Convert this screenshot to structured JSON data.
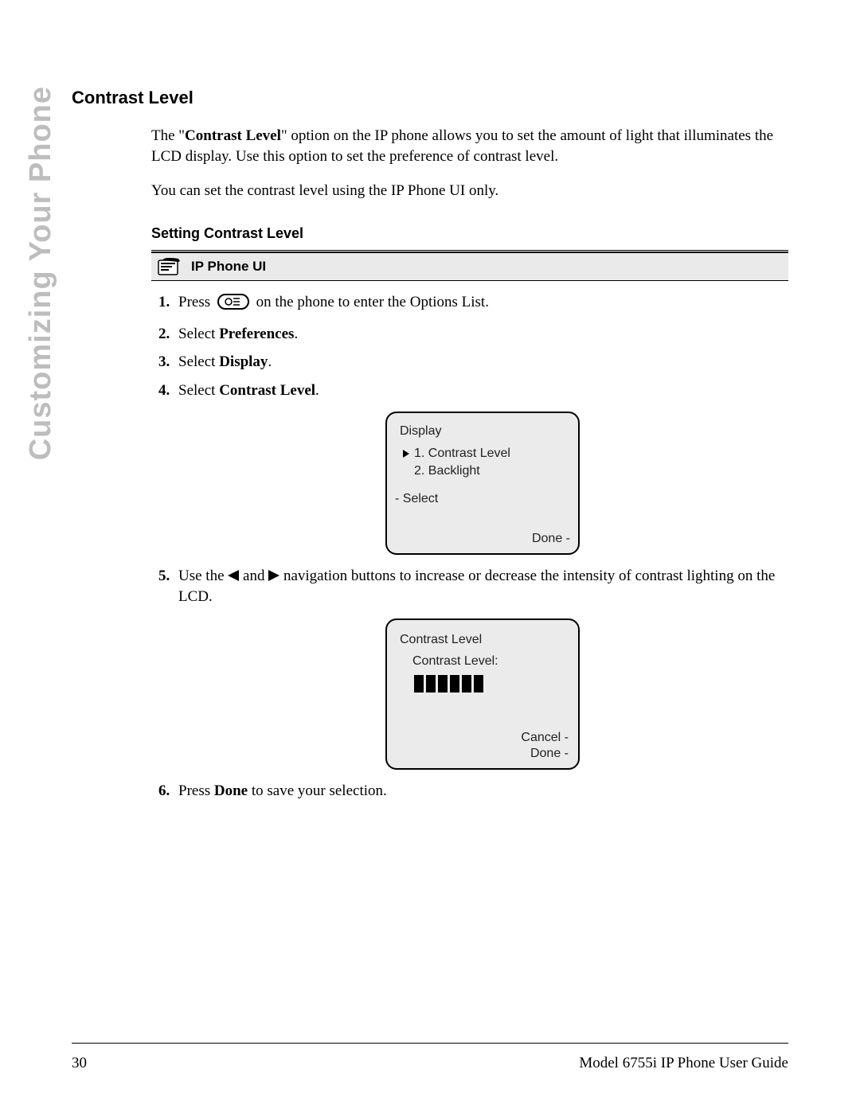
{
  "sideTab": "Customizing Your Phone",
  "sectionTitle": "Contrast Level",
  "intro1a": "The \"",
  "intro1b": "Contrast Level",
  "intro1c": "\" option on the IP phone allows you to set the amount of light that illuminates the LCD display. Use this option to set the preference of contrast level.",
  "intro2": "You can set the contrast level using the IP Phone UI only.",
  "subTitle": "Setting Contrast Level",
  "uiBand": "IP Phone UI",
  "steps": {
    "s1a": "Press ",
    "s1b": " on the phone to enter the Options List.",
    "s2a": "Select ",
    "s2b": "Preferences",
    "s2c": ".",
    "s3a": "Select ",
    "s3b": "Display",
    "s3c": ".",
    "s4a": "Select ",
    "s4b": "Contrast Level",
    "s4c": ".",
    "s5a": "Use the ",
    "s5b": " and ",
    "s5c": " navigation buttons to increase or decrease the intensity of contrast lighting on the LCD.",
    "s6a": "Press ",
    "s6b": "Done",
    "s6c": " to save your selection."
  },
  "lcd1": {
    "title": "Display",
    "item1": "1. Contrast Level",
    "item2": "2. Backlight",
    "softLeft": "- Select",
    "softRight": "Done -"
  },
  "lcd2": {
    "title": "Contrast Level",
    "label": "Contrast Level:",
    "softCancel": "Cancel -",
    "softDone": "Done -"
  },
  "footer": {
    "pageNum": "30",
    "guide": "Model 6755i IP Phone User Guide"
  }
}
